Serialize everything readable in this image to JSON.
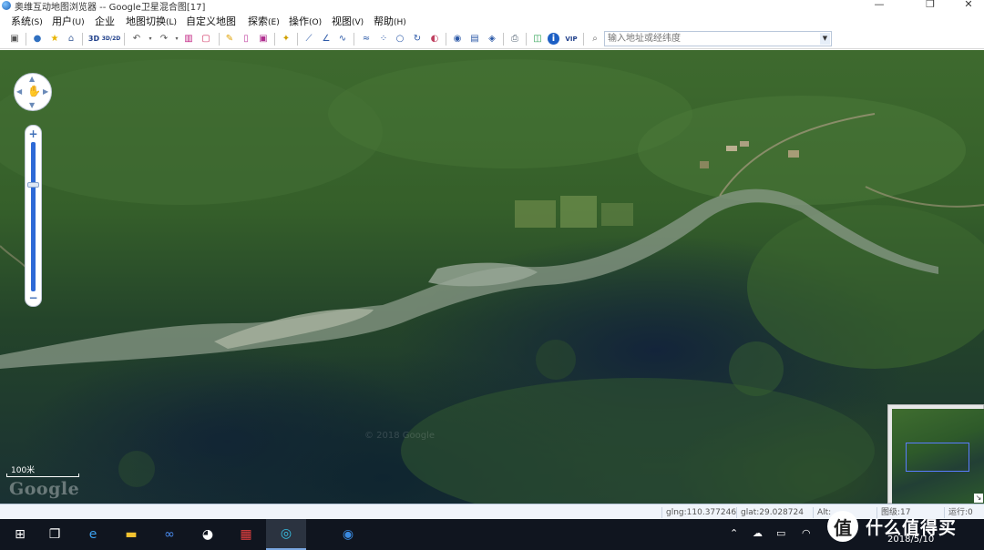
{
  "window": {
    "title": "奥维互动地图浏览器 -- Google卫星混合图[17]",
    "minimize": "—",
    "maximize": "❐",
    "close": "✕"
  },
  "menu": [
    {
      "label": "系统",
      "acc": "(S)"
    },
    {
      "label": "用户",
      "acc": "(U)"
    },
    {
      "label": "企业",
      "acc": ""
    },
    {
      "label": "地图切换",
      "acc": "(L)"
    },
    {
      "label": "自定义地图",
      "acc": ""
    },
    {
      "label": "探索",
      "acc": "(E)"
    },
    {
      "label": "操作",
      "acc": "(O)"
    },
    {
      "label": "视图",
      "acc": "(V)"
    },
    {
      "label": "帮助",
      "acc": "(H)"
    }
  ],
  "toolbar": {
    "btn_3d": "3D",
    "btn_3d2d": "3D/2D",
    "btn_vip": "VIP",
    "address_placeholder": "输入地址或经纬度"
  },
  "map": {
    "scale_label": "100米",
    "logo": "Google",
    "watermark": "© 2018 Google"
  },
  "status": {
    "glng": "glng:110.377246",
    "glat": "glat:29.028724",
    "alt": "Alt:",
    "level": "图级:17",
    "running": "运行:0"
  },
  "taskbar": {
    "date": "2018/5/10"
  },
  "brand": {
    "circle": "值",
    "text": "什么值得买"
  }
}
